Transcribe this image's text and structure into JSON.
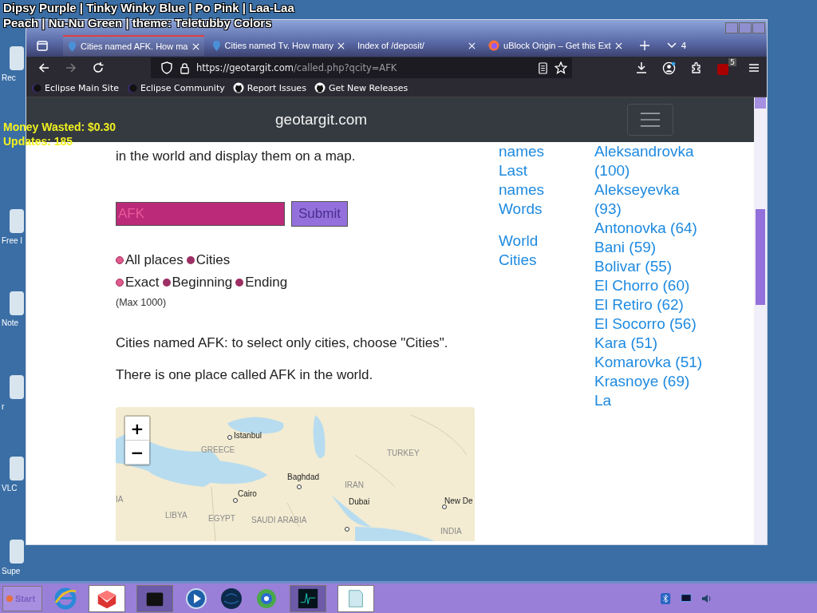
{
  "overlay": {
    "theme_text": "Dipsy Purple | Tinky Winky Blue | Po Pink | Laa-Laa Peach | Nu-Nu Green | theme: Teletubby Colors",
    "money": "Money Wasted: $0.30",
    "updates": "Updates: 185"
  },
  "desktop_icons": [
    {
      "label": "Rec"
    },
    {
      "label": "Free I"
    },
    {
      "label": "Note"
    },
    {
      "label": "r"
    },
    {
      "label": "VLC"
    },
    {
      "label": "Supe"
    }
  ],
  "window": {
    "tabs": [
      {
        "title": "Cities named AFK. How ma",
        "selected": true,
        "kind": "pin"
      },
      {
        "title": "Cities named Tv. How many",
        "selected": false,
        "kind": "pin"
      },
      {
        "title": "Index of /deposit/",
        "selected": false,
        "kind": "plain"
      },
      {
        "title": "uBlock Origin – Get this Ext",
        "selected": false,
        "kind": "firefox"
      }
    ],
    "tab_count": "4",
    "address": {
      "host": "https://geotargit.com",
      "path": "/called.php?qcity=AFK"
    },
    "bookmarks": [
      {
        "label": "Eclipse Main Site",
        "kind": "eclipse"
      },
      {
        "label": "Eclipse Community",
        "kind": "eclipse"
      },
      {
        "label": "Report Issues",
        "kind": "github"
      },
      {
        "label": "Get New Releases",
        "kind": "github"
      }
    ],
    "extension_badge": "5"
  },
  "page": {
    "site_title": "geotargit.com",
    "intro_tail": "in the world and display them on a map.",
    "search": {
      "value": "AFK",
      "button": "Submit"
    },
    "scope_options": [
      {
        "label": "All places",
        "selected": true
      },
      {
        "label": "Cities",
        "selected": false
      }
    ],
    "match_options": [
      {
        "label": "Exact",
        "selected": true
      },
      {
        "label": "Beginning",
        "selected": false
      },
      {
        "label": "Ending",
        "selected": false
      }
    ],
    "max_note": "(Max 1000)",
    "hint": "Cities named AFK: to select only cities, choose \"Cities\".",
    "result": "There is one place called AFK in the world.",
    "map": {
      "zoom_in": "+",
      "zoom_out": "−",
      "labels": [
        {
          "text": "Istanbul",
          "kind": "city"
        },
        {
          "text": "GREECE",
          "kind": "country"
        },
        {
          "text": "TURKEY",
          "kind": "country"
        },
        {
          "text": "Baghdad",
          "kind": "city"
        },
        {
          "text": "IRAN",
          "kind": "country"
        },
        {
          "text": "Cairo",
          "kind": "city"
        },
        {
          "text": "IA",
          "kind": "country"
        },
        {
          "text": "LIBYA",
          "kind": "country"
        },
        {
          "text": "EGYPT",
          "kind": "country"
        },
        {
          "text": "SAUDI ARABIA",
          "kind": "country"
        },
        {
          "text": "Dubai",
          "kind": "city"
        },
        {
          "text": "New De",
          "kind": "city"
        },
        {
          "text": "INDIA",
          "kind": "country"
        }
      ]
    },
    "nav_groups": [
      [
        "names",
        "Last names",
        "Words"
      ],
      [
        "World Cities"
      ]
    ],
    "cities": [
      "Aleksandrovka (100)",
      "Alekseyevka (93)",
      "Antonovka (64)",
      "Bani (59)",
      "Bolivar (55)",
      "El Chorro (60)",
      "El Retiro (62)",
      "El Socorro (56)",
      "Kara (51)",
      "Komarovka (51)",
      "Krasnoye (69)",
      "La"
    ]
  },
  "taskbar": {
    "start": "Start"
  }
}
